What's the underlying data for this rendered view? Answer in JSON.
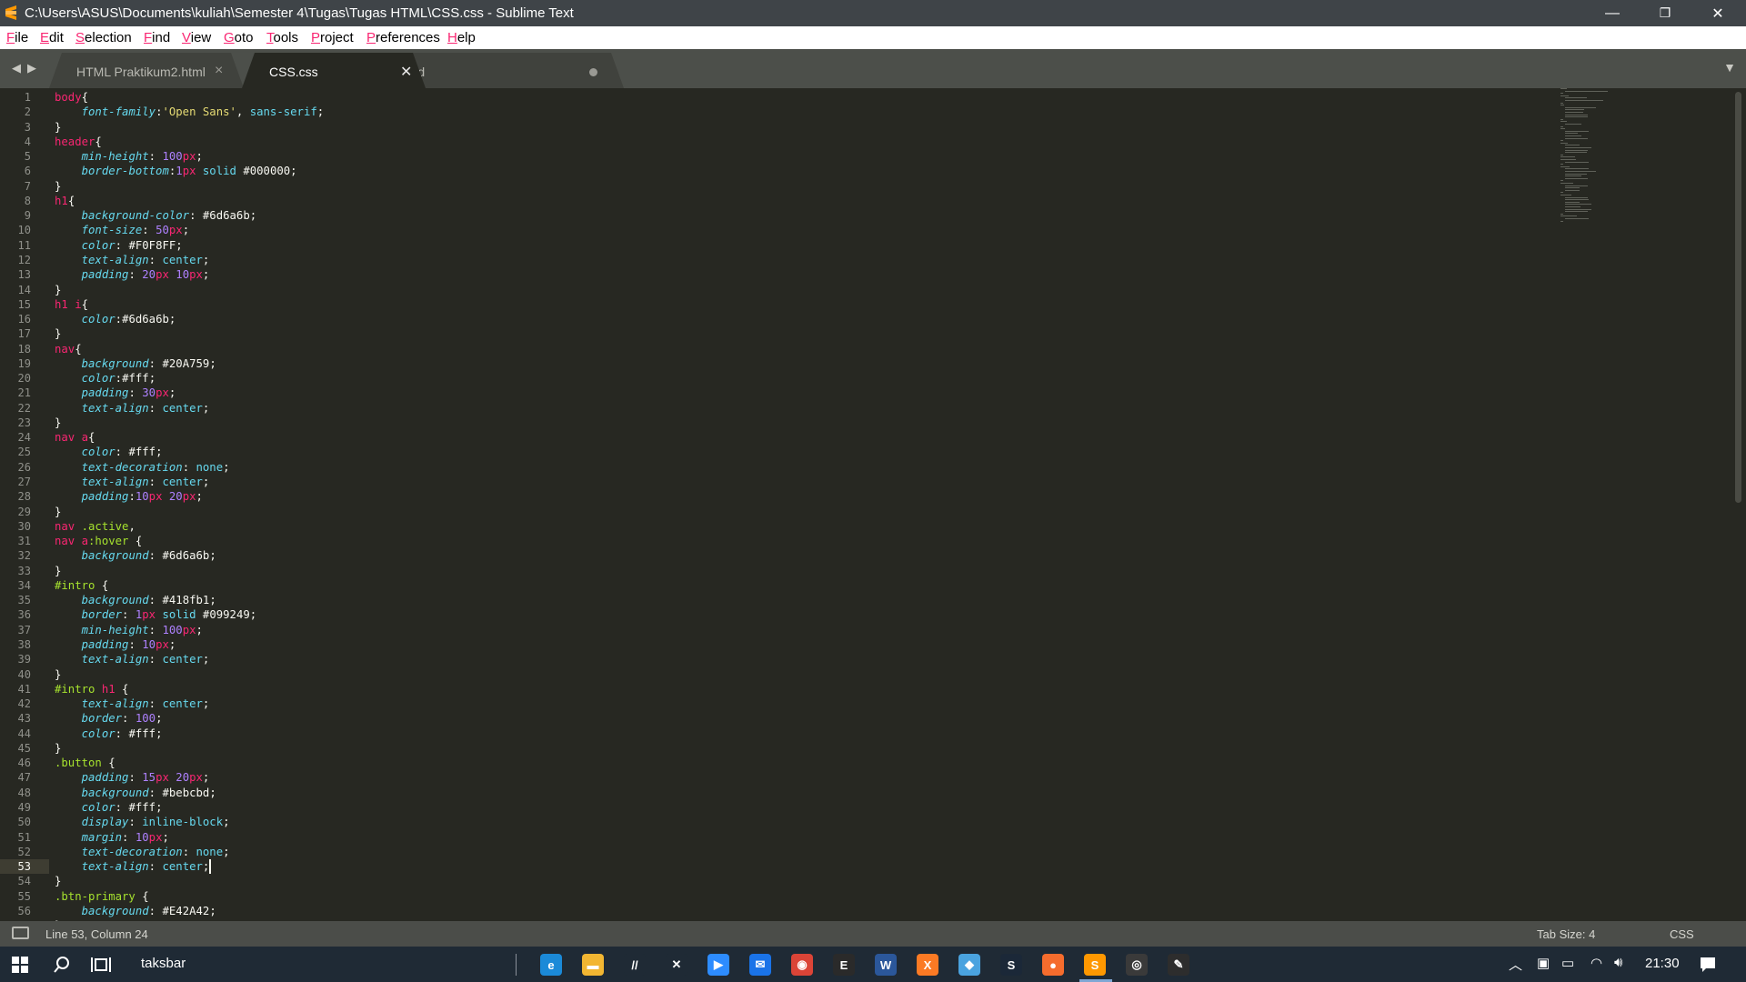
{
  "window": {
    "title": "C:\\Users\\ASUS\\Documents\\kuliah\\Semester 4\\Tugas\\Tugas HTML\\CSS.css - Sublime Text",
    "minimize": "—",
    "maximize": "❐",
    "close": "✕"
  },
  "menu": {
    "items": [
      {
        "u": "F",
        "rest": "ile"
      },
      {
        "u": "E",
        "rest": "dit"
      },
      {
        "u": "S",
        "rest": "election"
      },
      {
        "u": "F",
        "rest": "ind"
      },
      {
        "u": "V",
        "rest": "iew"
      },
      {
        "u": "G",
        "rest": "oto"
      },
      {
        "u": "T",
        "rest": "ools"
      },
      {
        "u": "P",
        "rest": "roject"
      },
      {
        "u": "P",
        "rest": "references"
      },
      {
        "u": "H",
        "rest": "elp"
      }
    ]
  },
  "tabs": [
    {
      "label": "HTML Praktikum2.html",
      "state": "close"
    },
    {
      "label": "CSS.css",
      "state": "close",
      "active": true
    },
    {
      "label": "untitled",
      "state": "dirty"
    }
  ],
  "editor": {
    "current_line": 53,
    "lines": [
      "body{",
      "    font-family:'Open Sans', sans-serif;",
      "}",
      "header{",
      "    min-height: 100px;",
      "    border-bottom:1px solid #000000;",
      "}",
      "h1{",
      "    background-color: #6d6a6b;",
      "    font-size: 50px;",
      "    color: #F0F8FF;",
      "    text-align: center;",
      "    padding: 20px 10px;",
      "}",
      "h1 i{",
      "    color:#6d6a6b;",
      "}",
      "nav{",
      "    background: #20A759;",
      "    color:#fff;",
      "    padding: 30px;",
      "    text-align: center;",
      "}",
      "nav a{",
      "    color: #fff;",
      "    text-decoration: none;",
      "    text-align: center;",
      "    padding:10px 20px;",
      "}",
      "nav .active,",
      "nav a:hover {",
      "    background: #6d6a6b;",
      "}",
      "#intro {",
      "    background: #418fb1;",
      "    border: 1px solid #099249;",
      "    min-height: 100px;",
      "    padding: 10px;",
      "    text-align: center;",
      "}",
      "#intro h1 {",
      "    text-align: center;",
      "    border: 100;",
      "    color: #fff;",
      "}",
      ".button {",
      "    padding: 15px 20px;",
      "    background: #bebcbd;",
      "    color: #fff;",
      "    display: inline-block;",
      "    margin: 10px;",
      "    text-decoration: none;",
      "    text-align: center;",
      "}",
      ".btn-primary {",
      "    background: #E42A42;",
      "}"
    ]
  },
  "status": {
    "position": "Line 53, Column 24",
    "tab_size": "Tab Size: 4",
    "syntax": "CSS"
  },
  "taskbar": {
    "search_label": "taksbar",
    "clock": "21:30",
    "icons": [
      {
        "name": "edge-icon",
        "color": "#1b8ad8",
        "glyph": "e"
      },
      {
        "name": "file-explorer-icon",
        "color": "#f2b632",
        "glyph": "▬"
      },
      {
        "name": "pen-app-icon",
        "color": "#1f2a35",
        "glyph": "//"
      },
      {
        "name": "xbox-icon",
        "color": "#1f2a35",
        "glyph": "✕"
      },
      {
        "name": "zoom-icon",
        "color": "#2d8cff",
        "glyph": "▶"
      },
      {
        "name": "mail-icon",
        "color": "#1a73e8",
        "glyph": "✉"
      },
      {
        "name": "chrome-icon",
        "color": "#db4437",
        "glyph": "◉"
      },
      {
        "name": "epic-games-icon",
        "color": "#2a2a2a",
        "glyph": "E"
      },
      {
        "name": "word-icon",
        "color": "#2b579a",
        "glyph": "W"
      },
      {
        "name": "xampp-icon",
        "color": "#fb7a24",
        "glyph": "X"
      },
      {
        "name": "virtualbox-icon",
        "color": "#4aa3df",
        "glyph": "◆"
      },
      {
        "name": "steam-icon",
        "color": "#1b2838",
        "glyph": "S"
      },
      {
        "name": "origin-icon",
        "color": "#f56c2d",
        "glyph": "●"
      },
      {
        "name": "sublime-text-icon",
        "color": "#ff9800",
        "glyph": "S"
      },
      {
        "name": "obs-icon",
        "color": "#3a3a3a",
        "glyph": "◎"
      },
      {
        "name": "vscode-icon",
        "color": "#2d2d2d",
        "glyph": "✎"
      }
    ]
  }
}
